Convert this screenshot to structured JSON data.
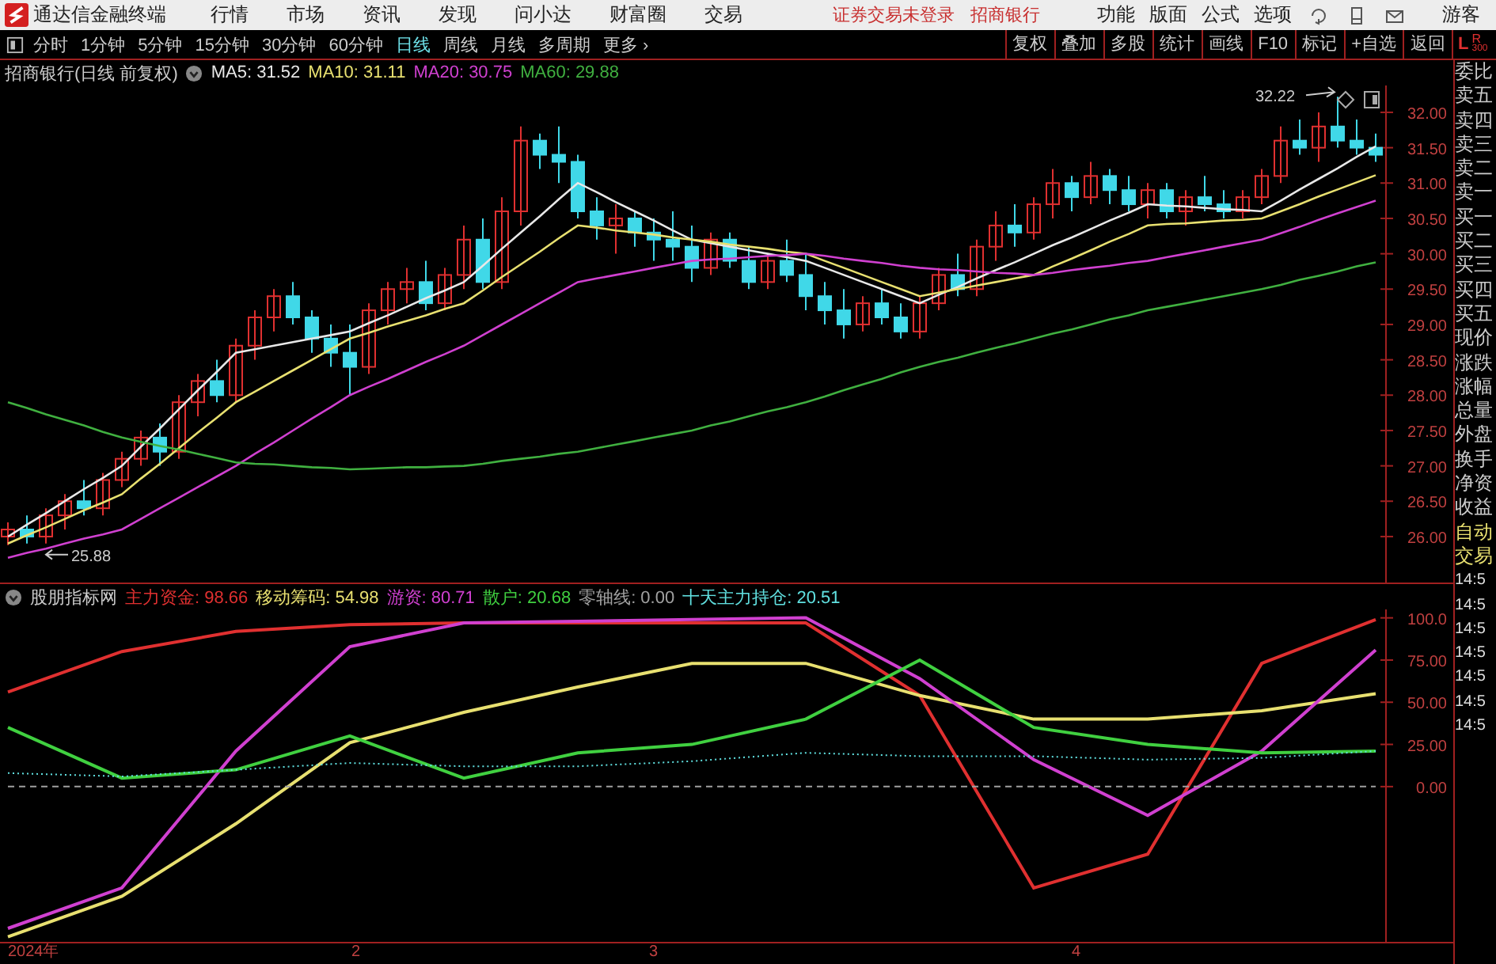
{
  "app": {
    "title": "通达信金融终端",
    "menu": [
      "行情",
      "市场",
      "资讯",
      "发现",
      "问小达",
      "财富圈",
      "交易"
    ],
    "status": [
      "证券交易未登录",
      "招商银行"
    ],
    "right_menu": [
      "功能",
      "版面",
      "公式",
      "选项"
    ],
    "user": "游客"
  },
  "periods": [
    {
      "label": "分时",
      "selected": false
    },
    {
      "label": "1分钟",
      "selected": false
    },
    {
      "label": "5分钟",
      "selected": false
    },
    {
      "label": "15分钟",
      "selected": false
    },
    {
      "label": "30分钟",
      "selected": false
    },
    {
      "label": "60分钟",
      "selected": false
    },
    {
      "label": "日线",
      "selected": true
    },
    {
      "label": "周线",
      "selected": false
    },
    {
      "label": "月线",
      "selected": false
    },
    {
      "label": "多周期",
      "selected": false
    },
    {
      "label": "更多 ›",
      "selected": false
    }
  ],
  "tools": [
    "复权",
    "叠加",
    "多股",
    "统计",
    "画线",
    "F10",
    "标记",
    "+自选",
    "返回"
  ],
  "corner_labels": [
    "L",
    "R",
    "300"
  ],
  "price_chart": {
    "title": "招商银行(日线 前复权)",
    "indicators": [
      {
        "text": "MA5: 31.52",
        "color": "#e8e8e8"
      },
      {
        "text": "MA10: 31.11",
        "color": "#e8e070"
      },
      {
        "text": "MA20: 30.75",
        "color": "#d040d0"
      },
      {
        "text": "MA60: 29.88",
        "color": "#40b040"
      }
    ],
    "chart_data": {
      "type": "candlestick",
      "ylim": [
        25.35,
        32.38
      ],
      "yticks": [
        {
          "value": 26,
          "label": "26.00"
        },
        {
          "value": 26.5,
          "label": "26.50"
        },
        {
          "value": 27,
          "label": "27.00"
        },
        {
          "value": 27.5,
          "label": "27.50"
        },
        {
          "value": 28,
          "label": "28.00"
        },
        {
          "value": 28.5,
          "label": "28.50"
        },
        {
          "value": 29,
          "label": "29.00"
        },
        {
          "value": 29.5,
          "label": "29.50"
        },
        {
          "value": 30,
          "label": "30.00"
        },
        {
          "value": 30.5,
          "label": "30.50"
        },
        {
          "value": 31,
          "label": "31.00"
        },
        {
          "value": 31.5,
          "label": "31.50"
        },
        {
          "value": 32,
          "label": "32.00"
        }
      ],
      "ohlc": [
        [
          26.0,
          26.2,
          25.88,
          26.1
        ],
        [
          26.1,
          26.3,
          25.9,
          26.0
        ],
        [
          26.0,
          26.4,
          25.9,
          26.3
        ],
        [
          26.3,
          26.6,
          26.1,
          26.5
        ],
        [
          26.5,
          26.8,
          26.3,
          26.4
        ],
        [
          26.4,
          26.9,
          26.3,
          26.8
        ],
        [
          26.8,
          27.2,
          26.7,
          27.1
        ],
        [
          27.1,
          27.5,
          27.0,
          27.4
        ],
        [
          27.4,
          27.6,
          27.0,
          27.2
        ],
        [
          27.2,
          28.0,
          27.1,
          27.9
        ],
        [
          27.9,
          28.3,
          27.7,
          28.2
        ],
        [
          28.2,
          28.5,
          27.9,
          28.0
        ],
        [
          28.0,
          28.8,
          27.9,
          28.7
        ],
        [
          28.7,
          29.2,
          28.5,
          29.1
        ],
        [
          29.1,
          29.5,
          28.9,
          29.4
        ],
        [
          29.4,
          29.6,
          29.0,
          29.1
        ],
        [
          29.1,
          29.2,
          28.6,
          28.8
        ],
        [
          28.8,
          29.0,
          28.4,
          28.6
        ],
        [
          28.6,
          29.0,
          28.0,
          28.4
        ],
        [
          28.4,
          29.3,
          28.3,
          29.2
        ],
        [
          29.2,
          29.6,
          29.0,
          29.5
        ],
        [
          29.5,
          29.8,
          29.3,
          29.6
        ],
        [
          29.6,
          29.9,
          29.2,
          29.3
        ],
        [
          29.3,
          29.8,
          29.2,
          29.7
        ],
        [
          29.7,
          30.4,
          29.5,
          30.2
        ],
        [
          30.2,
          30.5,
          29.5,
          29.6
        ],
        [
          29.6,
          30.8,
          29.5,
          30.6
        ],
        [
          30.6,
          31.8,
          30.4,
          31.6
        ],
        [
          31.6,
          31.7,
          31.2,
          31.4
        ],
        [
          31.4,
          31.8,
          31.0,
          31.3
        ],
        [
          31.3,
          31.4,
          30.5,
          30.6
        ],
        [
          30.6,
          30.8,
          30.2,
          30.4
        ],
        [
          30.4,
          30.7,
          30.0,
          30.5
        ],
        [
          30.5,
          30.6,
          30.1,
          30.3
        ],
        [
          30.3,
          30.5,
          29.9,
          30.2
        ],
        [
          30.2,
          30.6,
          29.9,
          30.1
        ],
        [
          30.1,
          30.4,
          29.6,
          29.8
        ],
        [
          29.8,
          30.3,
          29.7,
          30.2
        ],
        [
          30.2,
          30.3,
          29.8,
          29.9
        ],
        [
          29.9,
          30.1,
          29.5,
          29.6
        ],
        [
          29.6,
          30.0,
          29.5,
          29.9
        ],
        [
          29.9,
          30.2,
          29.6,
          29.7
        ],
        [
          29.7,
          30.0,
          29.2,
          29.4
        ],
        [
          29.4,
          29.6,
          29.0,
          29.2
        ],
        [
          29.2,
          29.5,
          28.8,
          29.0
        ],
        [
          29.0,
          29.4,
          28.9,
          29.3
        ],
        [
          29.3,
          29.5,
          29.0,
          29.1
        ],
        [
          29.1,
          29.3,
          28.8,
          28.9
        ],
        [
          28.9,
          29.4,
          28.8,
          29.3
        ],
        [
          29.3,
          29.8,
          29.2,
          29.7
        ],
        [
          29.7,
          30.0,
          29.4,
          29.5
        ],
        [
          29.5,
          30.2,
          29.4,
          30.1
        ],
        [
          30.1,
          30.6,
          29.9,
          30.4
        ],
        [
          30.4,
          30.7,
          30.1,
          30.3
        ],
        [
          30.3,
          30.8,
          30.2,
          30.7
        ],
        [
          30.7,
          31.2,
          30.5,
          31.0
        ],
        [
          31.0,
          31.1,
          30.6,
          30.8
        ],
        [
          30.8,
          31.3,
          30.7,
          31.1
        ],
        [
          31.1,
          31.2,
          30.7,
          30.9
        ],
        [
          30.9,
          31.1,
          30.6,
          30.7
        ],
        [
          30.7,
          31.0,
          30.5,
          30.9
        ],
        [
          30.9,
          31.0,
          30.5,
          30.6
        ],
        [
          30.6,
          30.9,
          30.4,
          30.8
        ],
        [
          30.8,
          31.1,
          30.6,
          30.7
        ],
        [
          30.7,
          30.9,
          30.5,
          30.6
        ],
        [
          30.6,
          30.9,
          30.5,
          30.8
        ],
        [
          30.8,
          31.2,
          30.7,
          31.1
        ],
        [
          31.1,
          31.8,
          31.0,
          31.6
        ],
        [
          31.6,
          31.9,
          31.4,
          31.5
        ],
        [
          31.5,
          32.0,
          31.3,
          31.8
        ],
        [
          31.8,
          32.22,
          31.5,
          31.6
        ],
        [
          31.6,
          31.9,
          31.4,
          31.5
        ],
        [
          31.5,
          31.7,
          31.3,
          31.4
        ]
      ],
      "series": [
        {
          "type": "line",
          "color": "#e8e8e8",
          "values": [
            26.0,
            26.17,
            26.33,
            26.5,
            26.67,
            26.83,
            27.0,
            27.27,
            27.53,
            27.8,
            28.07,
            28.33,
            28.6,
            28.65,
            28.7,
            28.75,
            28.8,
            28.85,
            28.9,
            29.02,
            29.13,
            29.25,
            29.37,
            29.48,
            29.6,
            29.83,
            30.07,
            30.3,
            30.53,
            30.77,
            31.0,
            30.87,
            30.73,
            30.6,
            30.47,
            30.33,
            30.2,
            30.15,
            30.1,
            30.05,
            30.0,
            29.95,
            29.9,
            29.8,
            29.7,
            29.6,
            29.5,
            29.4,
            29.3,
            29.42,
            29.53,
            29.65,
            29.77,
            29.88,
            30.0,
            30.12,
            30.23,
            30.35,
            30.47,
            30.58,
            30.7,
            30.68,
            30.67,
            30.65,
            30.63,
            30.62,
            30.6,
            30.75,
            30.91,
            31.06,
            31.21,
            31.37,
            31.52
          ]
        },
        {
          "type": "line",
          "color": "#e8e070",
          "values": [
            25.9,
            26.02,
            26.13,
            26.25,
            26.37,
            26.48,
            26.6,
            26.82,
            27.03,
            27.25,
            27.47,
            27.68,
            27.9,
            28.05,
            28.2,
            28.35,
            28.5,
            28.65,
            28.8,
            28.88,
            28.97,
            29.05,
            29.13,
            29.22,
            29.3,
            29.48,
            29.67,
            29.85,
            30.03,
            30.22,
            30.4,
            30.37,
            30.33,
            30.3,
            30.27,
            30.23,
            30.2,
            30.17,
            30.13,
            30.1,
            30.07,
            30.03,
            30.0,
            29.9,
            29.8,
            29.7,
            29.6,
            29.5,
            29.4,
            29.45,
            29.5,
            29.55,
            29.6,
            29.65,
            29.7,
            29.82,
            29.93,
            30.05,
            30.17,
            30.28,
            30.4,
            30.42,
            30.43,
            30.45,
            30.47,
            30.48,
            30.5,
            30.6,
            30.7,
            30.81,
            30.91,
            31.01,
            31.11
          ]
        },
        {
          "type": "line",
          "color": "#d040d0",
          "values": [
            25.7,
            25.77,
            25.83,
            25.9,
            25.97,
            26.03,
            26.1,
            26.25,
            26.4,
            26.55,
            26.7,
            26.85,
            27.0,
            27.17,
            27.33,
            27.5,
            27.67,
            27.83,
            28.0,
            28.12,
            28.23,
            28.35,
            28.47,
            28.58,
            28.7,
            28.85,
            29.0,
            29.15,
            29.3,
            29.45,
            29.6,
            29.65,
            29.7,
            29.75,
            29.8,
            29.85,
            29.9,
            29.92,
            29.93,
            29.95,
            29.97,
            29.98,
            30.0,
            29.97,
            29.93,
            29.9,
            29.87,
            29.83,
            29.8,
            29.78,
            29.77,
            29.75,
            29.73,
            29.72,
            29.7,
            29.73,
            29.77,
            29.8,
            29.83,
            29.87,
            29.9,
            29.95,
            30.0,
            30.05,
            30.1,
            30.15,
            30.2,
            30.29,
            30.38,
            30.48,
            30.57,
            30.66,
            30.75
          ]
        },
        {
          "type": "line",
          "color": "#40b040",
          "values": [
            27.9,
            27.82,
            27.73,
            27.65,
            27.57,
            27.48,
            27.4,
            27.34,
            27.28,
            27.23,
            27.17,
            27.11,
            27.05,
            27.03,
            27.02,
            27.0,
            26.98,
            26.97,
            26.95,
            26.96,
            26.97,
            26.98,
            26.98,
            26.99,
            27.0,
            27.03,
            27.07,
            27.1,
            27.13,
            27.17,
            27.2,
            27.25,
            27.3,
            27.35,
            27.4,
            27.45,
            27.5,
            27.57,
            27.63,
            27.7,
            27.77,
            27.83,
            27.9,
            27.98,
            28.07,
            28.15,
            28.23,
            28.32,
            28.4,
            28.47,
            28.53,
            28.6,
            28.67,
            28.73,
            28.8,
            28.87,
            28.93,
            29.0,
            29.07,
            29.13,
            29.2,
            29.25,
            29.3,
            29.35,
            29.4,
            29.45,
            29.5,
            29.56,
            29.63,
            29.69,
            29.75,
            29.82,
            29.88
          ]
        }
      ],
      "annotations": [
        "32.22",
        "25.88"
      ]
    }
  },
  "indicator_chart": {
    "title": "股朋指标网",
    "indicators": [
      {
        "text": "主力资金: 98.66",
        "color": "#e03030"
      },
      {
        "text": "移动筹码: 54.98",
        "color": "#e8e070"
      },
      {
        "text": "游资: 80.71",
        "color": "#d040d0"
      },
      {
        "text": "散户: 20.68",
        "color": "#40d040"
      },
      {
        "text": "零轴线: 0.00",
        "color": "#a0a0a0"
      },
      {
        "text": "十天主力持仓: 20.51",
        "color": "#60e0e0"
      }
    ],
    "chart_data": {
      "type": "line",
      "ylim": [
        -92,
        105
      ],
      "yticks": [
        {
          "value": 0,
          "label": "0.00"
        },
        {
          "value": 25,
          "label": "25.00"
        },
        {
          "value": 50,
          "label": "50.00"
        },
        {
          "value": 75,
          "label": "75.00"
        },
        {
          "value": 100,
          "label": "100.0"
        }
      ],
      "series": [
        {
          "color": "#e03030",
          "values": [
            56,
            80,
            92,
            96,
            97,
            97,
            97,
            97,
            54,
            -60,
            -40,
            73,
            99
          ]
        },
        {
          "color": "#e8e070",
          "values": [
            -89,
            -65,
            -22,
            26,
            44,
            59,
            73,
            73,
            54,
            40,
            40,
            45,
            55
          ]
        },
        {
          "color": "#d040d0",
          "values": [
            -84,
            -60,
            21,
            83,
            97,
            98,
            99,
            100,
            64,
            16,
            -17,
            21,
            81
          ]
        },
        {
          "color": "#40d040",
          "values": [
            35,
            5,
            10,
            30,
            5,
            20,
            25,
            40,
            75,
            35,
            25,
            20,
            21
          ]
        },
        {
          "color": "#a0a0a0",
          "line_style": "dashed",
          "values": [
            0,
            0,
            0,
            0,
            0,
            0,
            0,
            0,
            0,
            0,
            0,
            0,
            0
          ]
        },
        {
          "color": "#60e0e0",
          "line_style": "dotted",
          "values": [
            8,
            6,
            10,
            14,
            12,
            12,
            15,
            20,
            18,
            18,
            16,
            17,
            21
          ]
        }
      ]
    },
    "date_labels": [
      "2024年",
      "2",
      "3",
      "4"
    ]
  },
  "quote_panel": [
    "委比",
    "卖五",
    "卖四",
    "卖三",
    "卖二",
    "卖一",
    "买一",
    "买二",
    "买三",
    "买四",
    "买五",
    "现价",
    "涨跌",
    "涨幅",
    "总量",
    "外盘",
    "换手",
    "净资",
    "收益",
    "自动",
    "交易",
    "14:5",
    "14:5",
    "14:5",
    "14:5",
    "14:5",
    "14:5",
    "14:5"
  ]
}
